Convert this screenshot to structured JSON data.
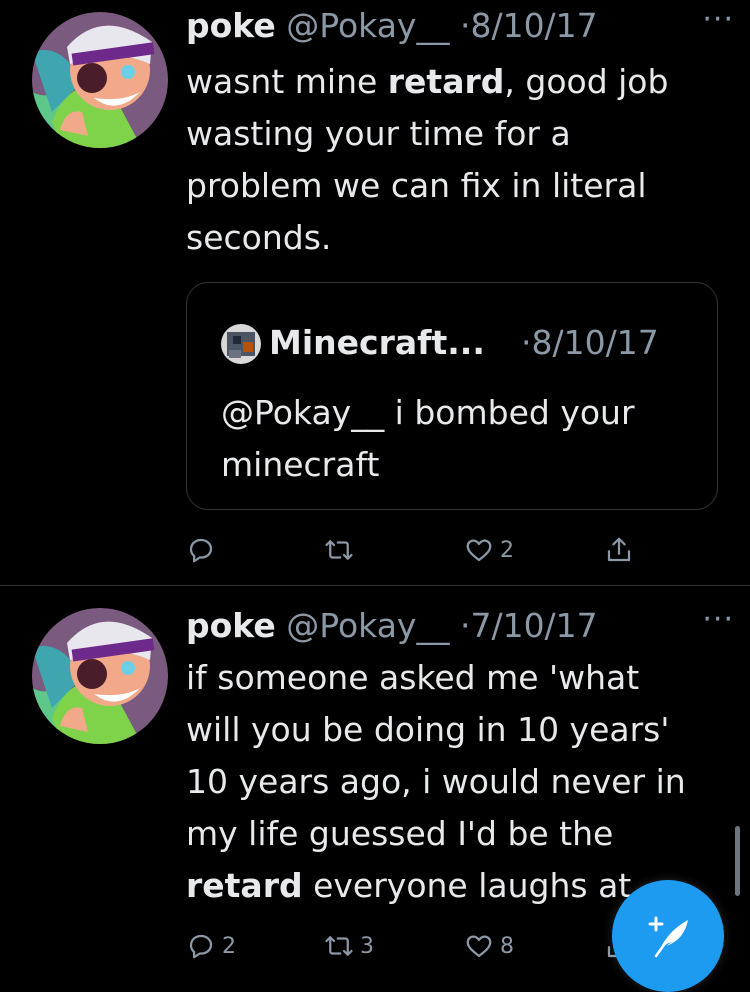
{
  "tweets": [
    {
      "name": "poke",
      "handle": "@Pokay__",
      "separator": "·",
      "date": "8/10/17",
      "more": "···",
      "text_lines": [
        {
          "parts": [
            {
              "t": "wasnt mine ",
              "b": false
            },
            {
              "t": "retard",
              "b": true
            },
            {
              "t": ", good job",
              "b": false
            }
          ]
        },
        {
          "parts": [
            {
              "t": "wasting your time for a",
              "b": false
            }
          ]
        },
        {
          "parts": [
            {
              "t": "problem we can fix in literal",
              "b": false
            }
          ]
        },
        {
          "parts": [
            {
              "t": "seconds.",
              "b": false
            }
          ]
        }
      ],
      "quote": {
        "name": "Minecraft...",
        "separator": "·",
        "date": "8/10/17",
        "text_lines": [
          "@Pokay__ i bombed your",
          "minecraft"
        ]
      },
      "actions": {
        "reply": "",
        "retweet": "",
        "like": "2"
      }
    },
    {
      "name": "poke",
      "handle": "@Pokay__",
      "separator": "·",
      "date": "7/10/17",
      "more": "···",
      "text_lines": [
        {
          "parts": [
            {
              "t": "if someone asked me 'what",
              "b": false
            }
          ]
        },
        {
          "parts": [
            {
              "t": "will you be doing in 10 years'",
              "b": false
            }
          ]
        },
        {
          "parts": [
            {
              "t": "10 years ago, i would never in",
              "b": false
            }
          ]
        },
        {
          "parts": [
            {
              "t": "my life guessed I'd be the",
              "b": false
            }
          ]
        },
        {
          "parts": [
            {
              "t": "retard",
              "b": true
            },
            {
              "t": " everyone laughs at",
              "b": false
            }
          ]
        }
      ],
      "actions": {
        "reply": "2",
        "retweet": "3",
        "like": "8"
      }
    }
  ],
  "icons": {
    "reply": "reply-icon",
    "retweet": "retweet-icon",
    "like": "heart-icon",
    "share": "share-icon",
    "compose": "compose-tweet-icon",
    "more": "more-icon"
  },
  "colors": {
    "background": "#000000",
    "text": "#e7e9ea",
    "muted": "#8b98a5",
    "accent": "#1d9bf0",
    "border": "#2f3336"
  }
}
